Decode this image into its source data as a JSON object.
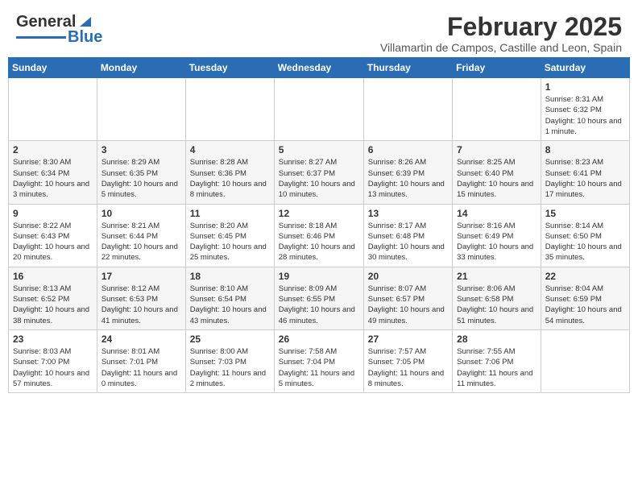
{
  "header": {
    "logo_general": "General",
    "logo_blue": "Blue",
    "title": "February 2025",
    "subtitle": "Villamartin de Campos, Castille and Leon, Spain"
  },
  "weekdays": [
    "Sunday",
    "Monday",
    "Tuesday",
    "Wednesday",
    "Thursday",
    "Friday",
    "Saturday"
  ],
  "weeks": [
    [
      {
        "day": "",
        "info": ""
      },
      {
        "day": "",
        "info": ""
      },
      {
        "day": "",
        "info": ""
      },
      {
        "day": "",
        "info": ""
      },
      {
        "day": "",
        "info": ""
      },
      {
        "day": "",
        "info": ""
      },
      {
        "day": "1",
        "info": "Sunrise: 8:31 AM\nSunset: 6:32 PM\nDaylight: 10 hours and 1 minute."
      }
    ],
    [
      {
        "day": "2",
        "info": "Sunrise: 8:30 AM\nSunset: 6:34 PM\nDaylight: 10 hours and 3 minutes."
      },
      {
        "day": "3",
        "info": "Sunrise: 8:29 AM\nSunset: 6:35 PM\nDaylight: 10 hours and 5 minutes."
      },
      {
        "day": "4",
        "info": "Sunrise: 8:28 AM\nSunset: 6:36 PM\nDaylight: 10 hours and 8 minutes."
      },
      {
        "day": "5",
        "info": "Sunrise: 8:27 AM\nSunset: 6:37 PM\nDaylight: 10 hours and 10 minutes."
      },
      {
        "day": "6",
        "info": "Sunrise: 8:26 AM\nSunset: 6:39 PM\nDaylight: 10 hours and 13 minutes."
      },
      {
        "day": "7",
        "info": "Sunrise: 8:25 AM\nSunset: 6:40 PM\nDaylight: 10 hours and 15 minutes."
      },
      {
        "day": "8",
        "info": "Sunrise: 8:23 AM\nSunset: 6:41 PM\nDaylight: 10 hours and 17 minutes."
      }
    ],
    [
      {
        "day": "9",
        "info": "Sunrise: 8:22 AM\nSunset: 6:43 PM\nDaylight: 10 hours and 20 minutes."
      },
      {
        "day": "10",
        "info": "Sunrise: 8:21 AM\nSunset: 6:44 PM\nDaylight: 10 hours and 22 minutes."
      },
      {
        "day": "11",
        "info": "Sunrise: 8:20 AM\nSunset: 6:45 PM\nDaylight: 10 hours and 25 minutes."
      },
      {
        "day": "12",
        "info": "Sunrise: 8:18 AM\nSunset: 6:46 PM\nDaylight: 10 hours and 28 minutes."
      },
      {
        "day": "13",
        "info": "Sunrise: 8:17 AM\nSunset: 6:48 PM\nDaylight: 10 hours and 30 minutes."
      },
      {
        "day": "14",
        "info": "Sunrise: 8:16 AM\nSunset: 6:49 PM\nDaylight: 10 hours and 33 minutes."
      },
      {
        "day": "15",
        "info": "Sunrise: 8:14 AM\nSunset: 6:50 PM\nDaylight: 10 hours and 35 minutes."
      }
    ],
    [
      {
        "day": "16",
        "info": "Sunrise: 8:13 AM\nSunset: 6:52 PM\nDaylight: 10 hours and 38 minutes."
      },
      {
        "day": "17",
        "info": "Sunrise: 8:12 AM\nSunset: 6:53 PM\nDaylight: 10 hours and 41 minutes."
      },
      {
        "day": "18",
        "info": "Sunrise: 8:10 AM\nSunset: 6:54 PM\nDaylight: 10 hours and 43 minutes."
      },
      {
        "day": "19",
        "info": "Sunrise: 8:09 AM\nSunset: 6:55 PM\nDaylight: 10 hours and 46 minutes."
      },
      {
        "day": "20",
        "info": "Sunrise: 8:07 AM\nSunset: 6:57 PM\nDaylight: 10 hours and 49 minutes."
      },
      {
        "day": "21",
        "info": "Sunrise: 8:06 AM\nSunset: 6:58 PM\nDaylight: 10 hours and 51 minutes."
      },
      {
        "day": "22",
        "info": "Sunrise: 8:04 AM\nSunset: 6:59 PM\nDaylight: 10 hours and 54 minutes."
      }
    ],
    [
      {
        "day": "23",
        "info": "Sunrise: 8:03 AM\nSunset: 7:00 PM\nDaylight: 10 hours and 57 minutes."
      },
      {
        "day": "24",
        "info": "Sunrise: 8:01 AM\nSunset: 7:01 PM\nDaylight: 11 hours and 0 minutes."
      },
      {
        "day": "25",
        "info": "Sunrise: 8:00 AM\nSunset: 7:03 PM\nDaylight: 11 hours and 2 minutes."
      },
      {
        "day": "26",
        "info": "Sunrise: 7:58 AM\nSunset: 7:04 PM\nDaylight: 11 hours and 5 minutes."
      },
      {
        "day": "27",
        "info": "Sunrise: 7:57 AM\nSunset: 7:05 PM\nDaylight: 11 hours and 8 minutes."
      },
      {
        "day": "28",
        "info": "Sunrise: 7:55 AM\nSunset: 7:06 PM\nDaylight: 11 hours and 11 minutes."
      },
      {
        "day": "",
        "info": ""
      }
    ]
  ]
}
